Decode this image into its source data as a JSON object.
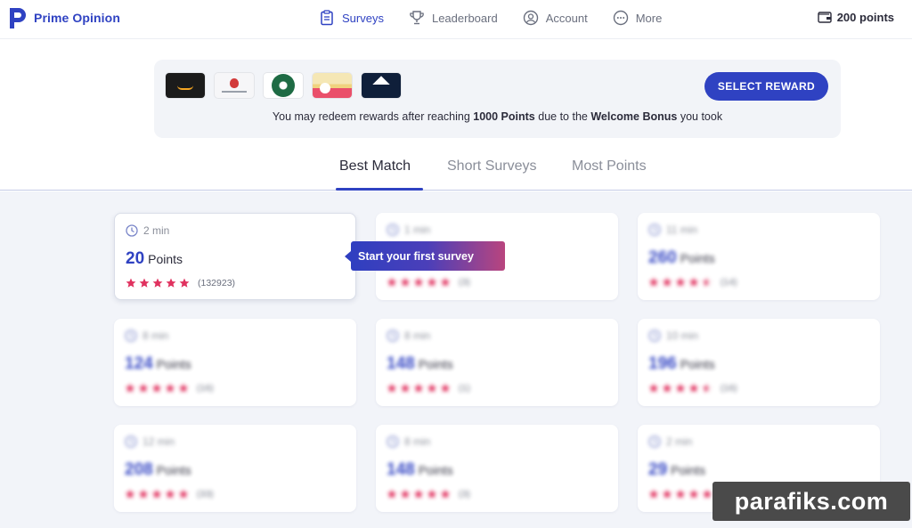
{
  "brand": {
    "name": "Prime Opinion",
    "color": "#2f42c2"
  },
  "nav": {
    "items": [
      {
        "label": "Surveys",
        "icon": "clipboard-icon",
        "active": true
      },
      {
        "label": "Leaderboard",
        "icon": "trophy-icon",
        "active": false
      },
      {
        "label": "Account",
        "icon": "user-circle-icon",
        "active": false
      },
      {
        "label": "More",
        "icon": "more-dots-icon",
        "active": false
      }
    ],
    "balance": "200 points"
  },
  "banner": {
    "gift_cards": [
      "amazon",
      "apple",
      "starbucks",
      "confetti",
      "american-eagle"
    ],
    "select_button": "SELECT REWARD",
    "redeem_prefix": "You may redeem rewards after reaching ",
    "redeem_threshold": "1000 Points",
    "redeem_middle": " due to the ",
    "redeem_bonus": "Welcome Bonus",
    "redeem_suffix": " you took"
  },
  "tabs": [
    {
      "label": "Best Match",
      "active": true
    },
    {
      "label": "Short Surveys",
      "active": false
    },
    {
      "label": "Most Points",
      "active": false
    }
  ],
  "tooltip": "Start your first survey",
  "surveys": [
    {
      "duration": "2 min",
      "points": "20",
      "unit": "Points",
      "stars": 5,
      "count": "(132923)"
    },
    {
      "duration": "1 min",
      "points": "",
      "unit": "",
      "stars": 5,
      "count": "(3)"
    },
    {
      "duration": "11 min",
      "points": "260",
      "unit": "Points",
      "stars": 4.5,
      "count": "(14)"
    },
    {
      "duration": "8 min",
      "points": "124",
      "unit": "Points",
      "stars": 5,
      "count": "(16)"
    },
    {
      "duration": "8 min",
      "points": "148",
      "unit": "Points",
      "stars": 5,
      "count": "(1)"
    },
    {
      "duration": "10 min",
      "points": "196",
      "unit": "Points",
      "stars": 4.5,
      "count": "(16)"
    },
    {
      "duration": "12 min",
      "points": "208",
      "unit": "Points",
      "stars": 5,
      "count": "(33)"
    },
    {
      "duration": "8 min",
      "points": "148",
      "unit": "Points",
      "stars": 5,
      "count": "(3)"
    },
    {
      "duration": "2 min",
      "points": "29",
      "unit": "Points",
      "stars": 5,
      "count": "(9)"
    }
  ],
  "watermark": "parafiks.com",
  "colors": {
    "accent": "#2f42c2",
    "star": "#e0325f",
    "grid_bg": "#f2f4f9"
  }
}
